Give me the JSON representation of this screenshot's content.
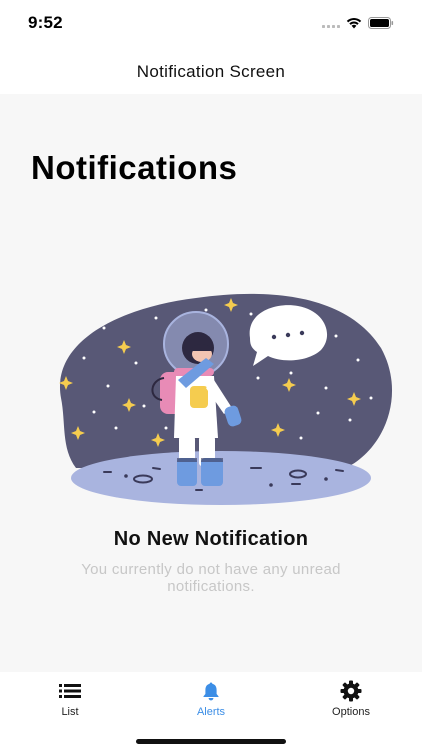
{
  "status_bar": {
    "time": "9:52",
    "icons": [
      "signal-icon",
      "wifi-icon",
      "battery-icon"
    ]
  },
  "nav": {
    "title": "Notification Screen"
  },
  "page": {
    "heading": "Notifications",
    "empty_state": {
      "title": "No New Notification",
      "message": "You currently do not have any unread notifications.",
      "illustration": "astronaut-illustration"
    }
  },
  "tab_bar": {
    "items": [
      {
        "label": "List",
        "icon": "list-icon",
        "active": false
      },
      {
        "label": "Alerts",
        "icon": "bell-icon",
        "active": true
      },
      {
        "label": "Options",
        "icon": "gear-icon",
        "active": false
      }
    ]
  },
  "colors": {
    "accent": "#3c8ee6",
    "background": "#f7f7f7",
    "space": "#585876",
    "muted_text": "#c7c7c7"
  }
}
